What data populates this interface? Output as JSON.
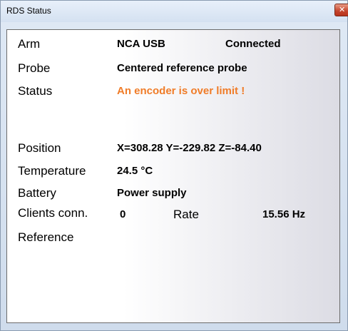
{
  "window": {
    "title": "RDS Status",
    "close_icon": "close-icon"
  },
  "fields": {
    "arm": {
      "label": "Arm",
      "value": "NCA USB",
      "status": "Connected"
    },
    "probe": {
      "label": "Probe",
      "value": "Centered reference probe"
    },
    "status": {
      "label": "Status",
      "value": "An encoder is over limit !"
    },
    "position": {
      "label": "Position",
      "value": "X=308.28  Y=-229.82  Z=-84.40"
    },
    "temperature": {
      "label": "Temperature",
      "value": "24.5 °C"
    },
    "battery": {
      "label": "Battery",
      "value": "Power supply"
    },
    "clients": {
      "label": "Clients conn.",
      "value": "0",
      "rate_label": "Rate",
      "rate_value": "15.56 Hz"
    },
    "reference": {
      "label": "Reference",
      "value": ""
    }
  },
  "colors": {
    "warning": "#f07c28",
    "panel_border": "#6b6b6b",
    "close_button": "#c4432b"
  }
}
